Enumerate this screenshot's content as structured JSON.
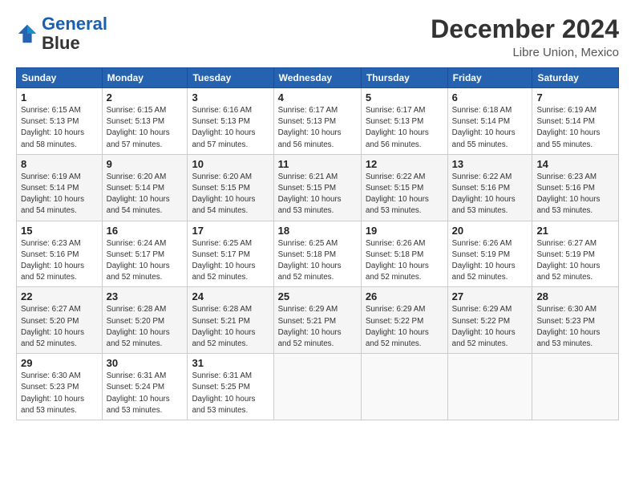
{
  "logo": {
    "line1": "General",
    "line2": "Blue"
  },
  "title": "December 2024",
  "subtitle": "Libre Union, Mexico",
  "weekdays": [
    "Sunday",
    "Monday",
    "Tuesday",
    "Wednesday",
    "Thursday",
    "Friday",
    "Saturday"
  ],
  "weeks": [
    [
      {
        "day": "1",
        "sunrise": "Sunrise: 6:15 AM",
        "sunset": "Sunset: 5:13 PM",
        "daylight": "Daylight: 10 hours and 58 minutes."
      },
      {
        "day": "2",
        "sunrise": "Sunrise: 6:15 AM",
        "sunset": "Sunset: 5:13 PM",
        "daylight": "Daylight: 10 hours and 57 minutes."
      },
      {
        "day": "3",
        "sunrise": "Sunrise: 6:16 AM",
        "sunset": "Sunset: 5:13 PM",
        "daylight": "Daylight: 10 hours and 57 minutes."
      },
      {
        "day": "4",
        "sunrise": "Sunrise: 6:17 AM",
        "sunset": "Sunset: 5:13 PM",
        "daylight": "Daylight: 10 hours and 56 minutes."
      },
      {
        "day": "5",
        "sunrise": "Sunrise: 6:17 AM",
        "sunset": "Sunset: 5:13 PM",
        "daylight": "Daylight: 10 hours and 56 minutes."
      },
      {
        "day": "6",
        "sunrise": "Sunrise: 6:18 AM",
        "sunset": "Sunset: 5:14 PM",
        "daylight": "Daylight: 10 hours and 55 minutes."
      },
      {
        "day": "7",
        "sunrise": "Sunrise: 6:19 AM",
        "sunset": "Sunset: 5:14 PM",
        "daylight": "Daylight: 10 hours and 55 minutes."
      }
    ],
    [
      {
        "day": "8",
        "sunrise": "Sunrise: 6:19 AM",
        "sunset": "Sunset: 5:14 PM",
        "daylight": "Daylight: 10 hours and 54 minutes."
      },
      {
        "day": "9",
        "sunrise": "Sunrise: 6:20 AM",
        "sunset": "Sunset: 5:14 PM",
        "daylight": "Daylight: 10 hours and 54 minutes."
      },
      {
        "day": "10",
        "sunrise": "Sunrise: 6:20 AM",
        "sunset": "Sunset: 5:15 PM",
        "daylight": "Daylight: 10 hours and 54 minutes."
      },
      {
        "day": "11",
        "sunrise": "Sunrise: 6:21 AM",
        "sunset": "Sunset: 5:15 PM",
        "daylight": "Daylight: 10 hours and 53 minutes."
      },
      {
        "day": "12",
        "sunrise": "Sunrise: 6:22 AM",
        "sunset": "Sunset: 5:15 PM",
        "daylight": "Daylight: 10 hours and 53 minutes."
      },
      {
        "day": "13",
        "sunrise": "Sunrise: 6:22 AM",
        "sunset": "Sunset: 5:16 PM",
        "daylight": "Daylight: 10 hours and 53 minutes."
      },
      {
        "day": "14",
        "sunrise": "Sunrise: 6:23 AM",
        "sunset": "Sunset: 5:16 PM",
        "daylight": "Daylight: 10 hours and 53 minutes."
      }
    ],
    [
      {
        "day": "15",
        "sunrise": "Sunrise: 6:23 AM",
        "sunset": "Sunset: 5:16 PM",
        "daylight": "Daylight: 10 hours and 52 minutes."
      },
      {
        "day": "16",
        "sunrise": "Sunrise: 6:24 AM",
        "sunset": "Sunset: 5:17 PM",
        "daylight": "Daylight: 10 hours and 52 minutes."
      },
      {
        "day": "17",
        "sunrise": "Sunrise: 6:25 AM",
        "sunset": "Sunset: 5:17 PM",
        "daylight": "Daylight: 10 hours and 52 minutes."
      },
      {
        "day": "18",
        "sunrise": "Sunrise: 6:25 AM",
        "sunset": "Sunset: 5:18 PM",
        "daylight": "Daylight: 10 hours and 52 minutes."
      },
      {
        "day": "19",
        "sunrise": "Sunrise: 6:26 AM",
        "sunset": "Sunset: 5:18 PM",
        "daylight": "Daylight: 10 hours and 52 minutes."
      },
      {
        "day": "20",
        "sunrise": "Sunrise: 6:26 AM",
        "sunset": "Sunset: 5:19 PM",
        "daylight": "Daylight: 10 hours and 52 minutes."
      },
      {
        "day": "21",
        "sunrise": "Sunrise: 6:27 AM",
        "sunset": "Sunset: 5:19 PM",
        "daylight": "Daylight: 10 hours and 52 minutes."
      }
    ],
    [
      {
        "day": "22",
        "sunrise": "Sunrise: 6:27 AM",
        "sunset": "Sunset: 5:20 PM",
        "daylight": "Daylight: 10 hours and 52 minutes."
      },
      {
        "day": "23",
        "sunrise": "Sunrise: 6:28 AM",
        "sunset": "Sunset: 5:20 PM",
        "daylight": "Daylight: 10 hours and 52 minutes."
      },
      {
        "day": "24",
        "sunrise": "Sunrise: 6:28 AM",
        "sunset": "Sunset: 5:21 PM",
        "daylight": "Daylight: 10 hours and 52 minutes."
      },
      {
        "day": "25",
        "sunrise": "Sunrise: 6:29 AM",
        "sunset": "Sunset: 5:21 PM",
        "daylight": "Daylight: 10 hours and 52 minutes."
      },
      {
        "day": "26",
        "sunrise": "Sunrise: 6:29 AM",
        "sunset": "Sunset: 5:22 PM",
        "daylight": "Daylight: 10 hours and 52 minutes."
      },
      {
        "day": "27",
        "sunrise": "Sunrise: 6:29 AM",
        "sunset": "Sunset: 5:22 PM",
        "daylight": "Daylight: 10 hours and 52 minutes."
      },
      {
        "day": "28",
        "sunrise": "Sunrise: 6:30 AM",
        "sunset": "Sunset: 5:23 PM",
        "daylight": "Daylight: 10 hours and 53 minutes."
      }
    ],
    [
      {
        "day": "29",
        "sunrise": "Sunrise: 6:30 AM",
        "sunset": "Sunset: 5:23 PM",
        "daylight": "Daylight: 10 hours and 53 minutes."
      },
      {
        "day": "30",
        "sunrise": "Sunrise: 6:31 AM",
        "sunset": "Sunset: 5:24 PM",
        "daylight": "Daylight: 10 hours and 53 minutes."
      },
      {
        "day": "31",
        "sunrise": "Sunrise: 6:31 AM",
        "sunset": "Sunset: 5:25 PM",
        "daylight": "Daylight: 10 hours and 53 minutes."
      },
      null,
      null,
      null,
      null
    ]
  ]
}
